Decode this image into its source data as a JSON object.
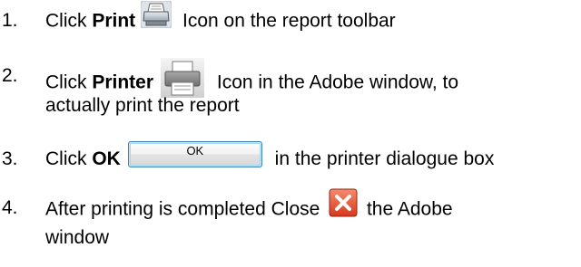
{
  "steps": [
    {
      "number": "1.",
      "pre": "Click ",
      "bold": "Print",
      "icon": "toolbar-print-icon",
      "post": " Icon on the report toolbar"
    },
    {
      "number": "2.",
      "pre": "Click ",
      "bold": "Printer",
      "icon": "adobe-printer-icon",
      "post": " Icon in the Adobe window, to",
      "line2": "actually print the report"
    },
    {
      "number": "3.",
      "pre": "Click ",
      "bold": "OK",
      "button_label": "OK",
      "post": " in the printer dialogue box"
    },
    {
      "number": "4.",
      "pre": "After printing is completed Close ",
      "icon": "close-icon",
      "post": " the Adobe",
      "line2": "window"
    }
  ],
  "colors": {
    "close_red": "#e8452b",
    "ok_border": "#3c7fb1"
  }
}
